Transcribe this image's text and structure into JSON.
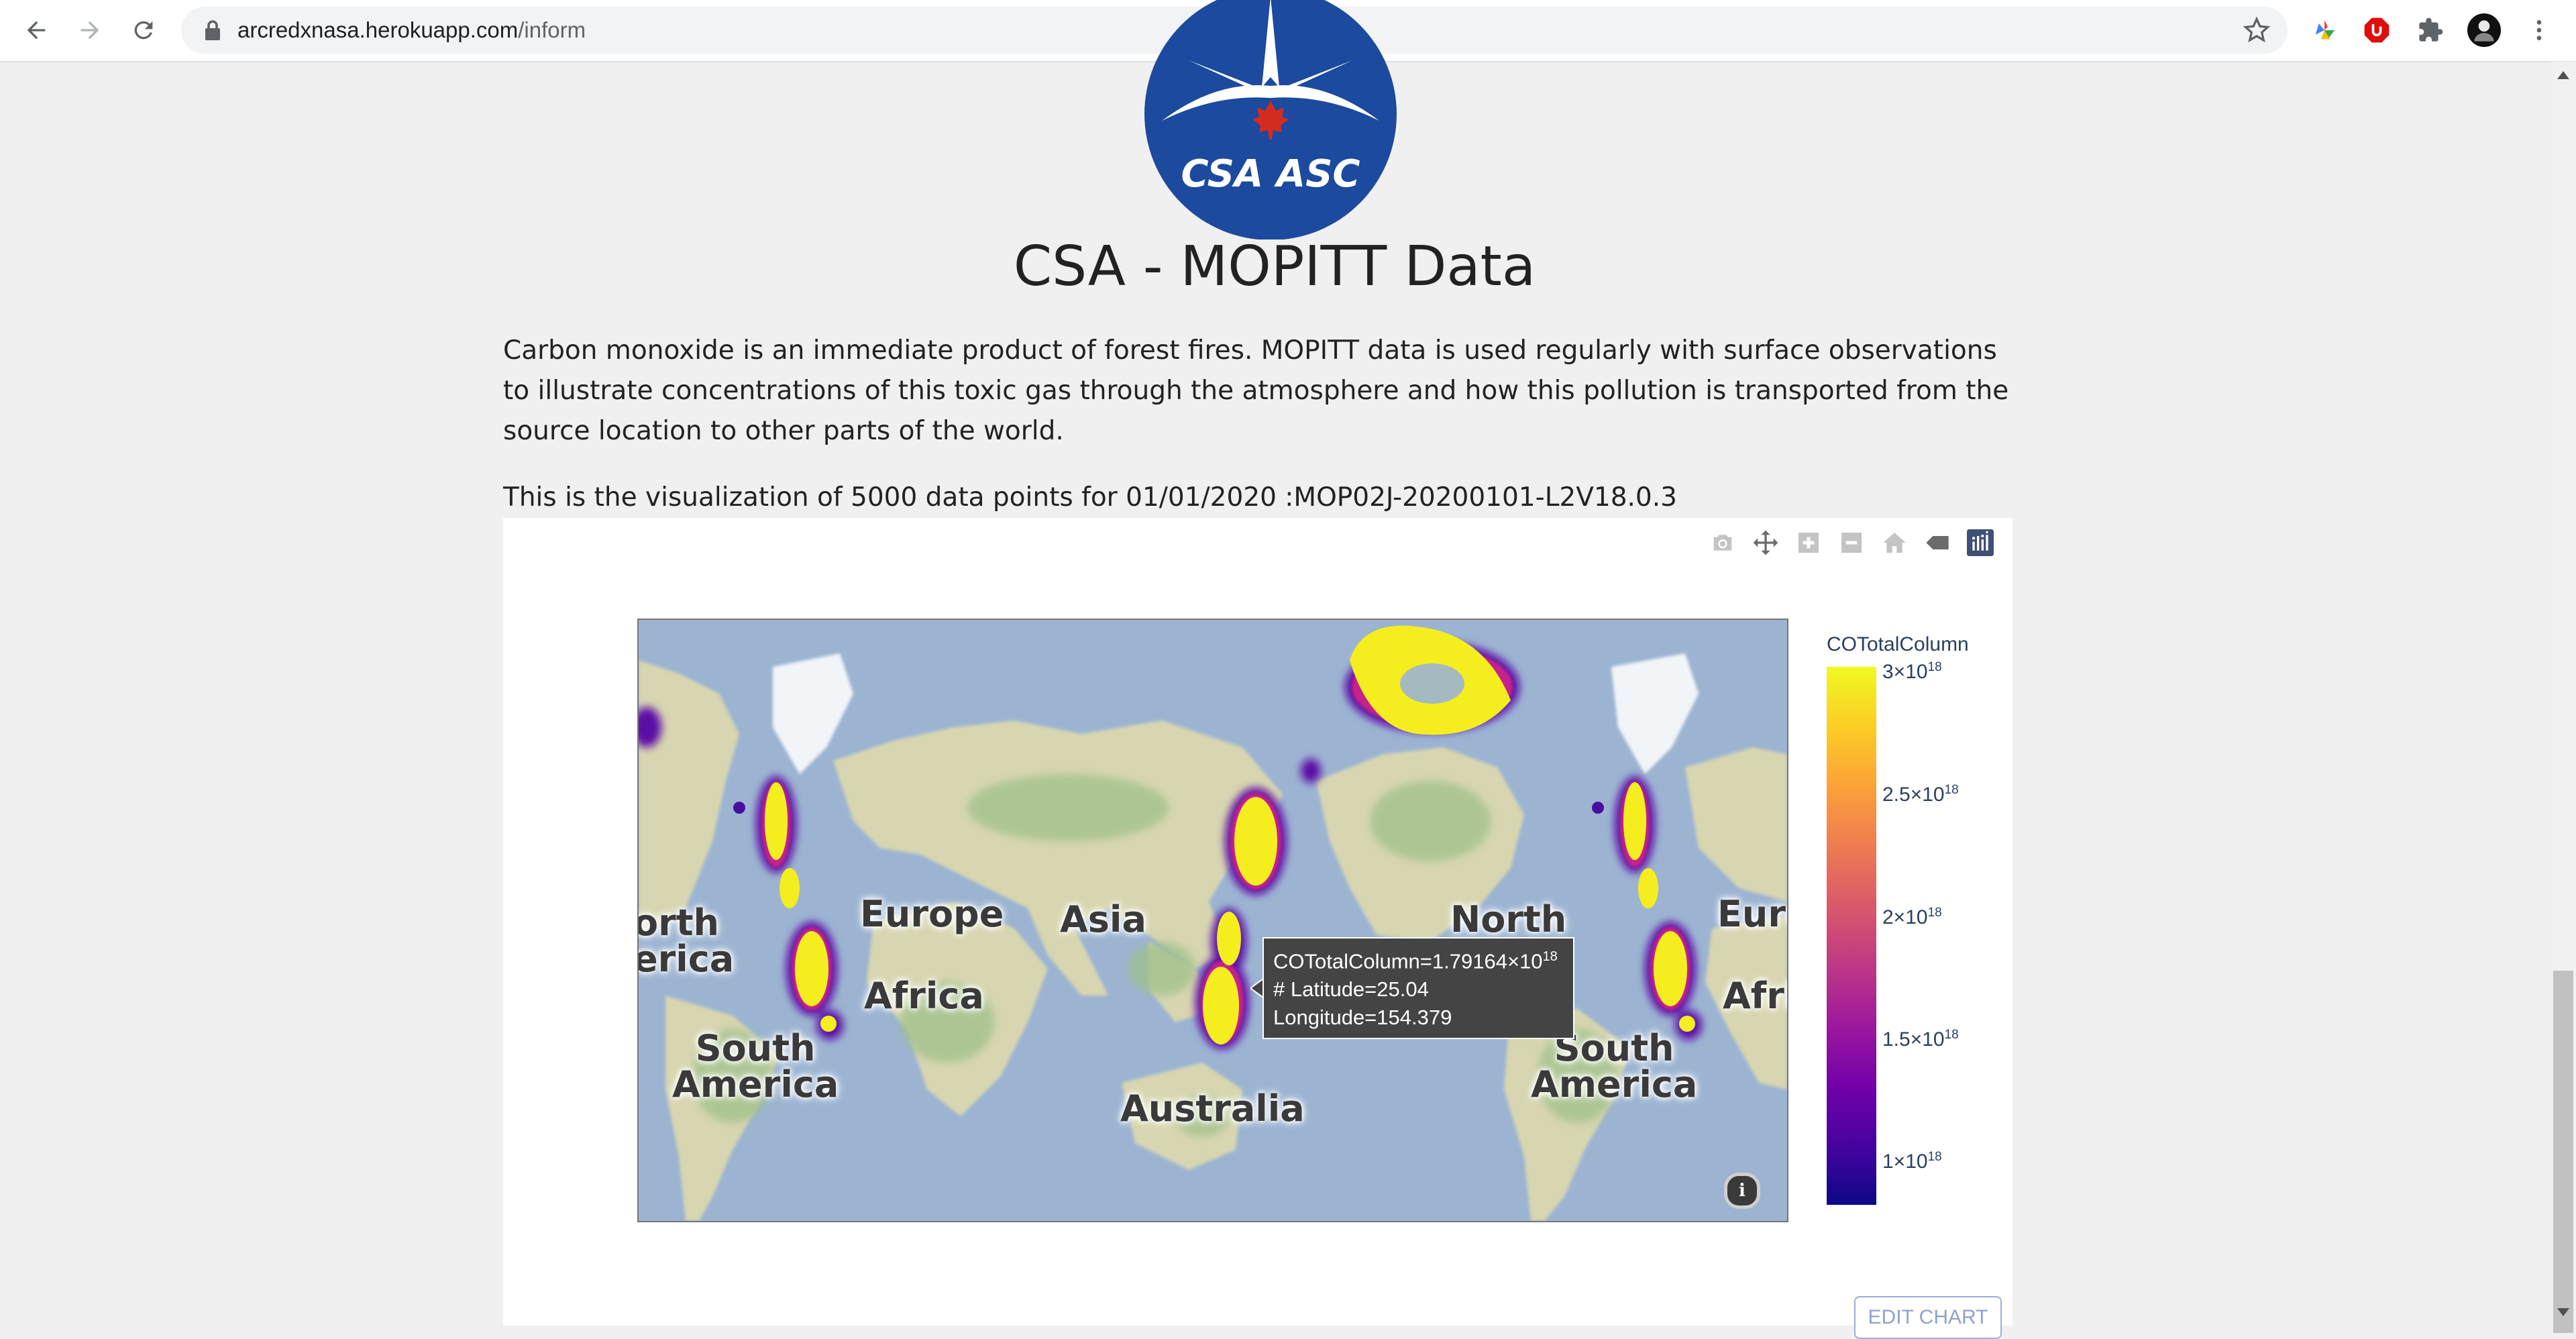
{
  "browser": {
    "url_host": "arcredxnasa.herokuapp.com",
    "url_path": "/inform"
  },
  "logo": {
    "text": "CSA ASC"
  },
  "page": {
    "title": "CSA - MOPITT Data",
    "intro": "Carbon monoxide is an immediate product of forest fires. MOPITT data is used regularly with surface observations to illustrate concentrations of this toxic gas through the atmosphere and how this pollution is transported from the source location to other parts of the world.",
    "viz_caption": "This is the visualization of 5000 data points for 01/01/2020 :MOP02J-20200101-L2V18.0.3"
  },
  "modebar": {
    "icons": [
      "camera-icon",
      "pan-icon",
      "zoom-in-icon",
      "zoom-out-icon",
      "home-icon",
      "hover-icon",
      "plotly-logo-icon"
    ]
  },
  "map": {
    "labels": {
      "north_america_left": "orth\nerica",
      "europe": "Europe",
      "asia": "Asia",
      "africa": "Africa",
      "south_america": "South\nAmerica",
      "australia": "Australia",
      "north_right": "North",
      "south_america_right": "South\nAmerica",
      "europe_right": "Eurc",
      "africa_right": "Afri"
    },
    "info_icon": "i"
  },
  "tooltip": {
    "line1_prefix": "COTotalColumn=1.79164×10",
    "line1_exp": "18",
    "line2": "# Latitude=25.04",
    "line3": "Longitude=154.379"
  },
  "colorbar": {
    "title": "COTotalColumn",
    "ticks": [
      {
        "mantissa": "3×10",
        "exp": "18"
      },
      {
        "mantissa": "2.5×10",
        "exp": "18"
      },
      {
        "mantissa": "2×10",
        "exp": "18"
      },
      {
        "mantissa": "1.5×10",
        "exp": "18"
      },
      {
        "mantissa": "1×10",
        "exp": "18"
      }
    ],
    "colors": [
      "#0d0887",
      "#7201a8",
      "#bd3786",
      "#ed7953",
      "#fdca26",
      "#f0f921"
    ]
  },
  "edit_chart_label": "EDIT CHART"
}
